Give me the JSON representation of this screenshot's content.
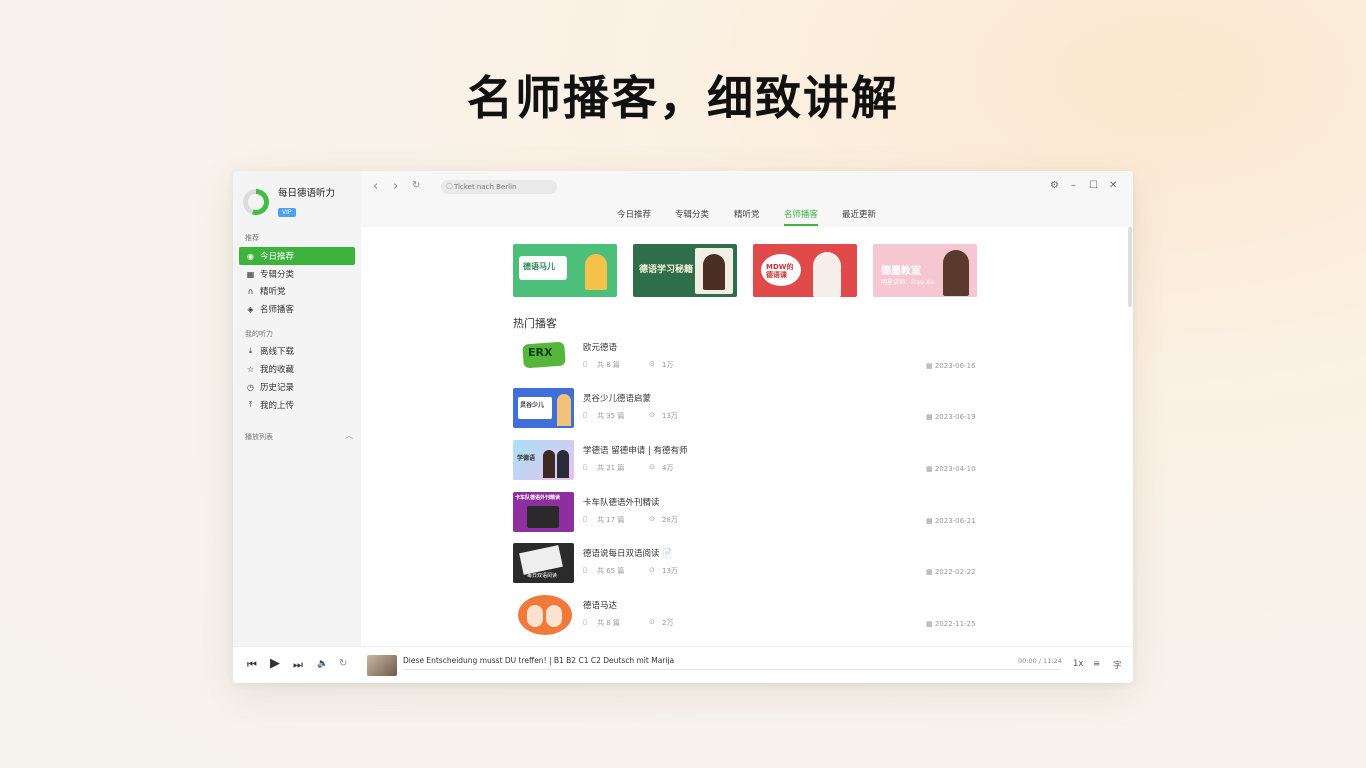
{
  "headline": "名师播客，细致讲解",
  "app": {
    "name": "每日德语听力",
    "badge": "VIP"
  },
  "sidebar": {
    "section1": "推荐",
    "items": [
      {
        "label": "今日推荐",
        "icon": "compass-icon"
      },
      {
        "label": "专辑分类",
        "icon": "grid-icon"
      },
      {
        "label": "精听党",
        "icon": "headphones-icon"
      },
      {
        "label": "名师播客",
        "icon": "podcast-icon"
      }
    ],
    "section2": "我的听力",
    "my_items": [
      {
        "label": "离线下载",
        "icon": "download-icon"
      },
      {
        "label": "我的收藏",
        "icon": "star-icon"
      },
      {
        "label": "历史记录",
        "icon": "clock-icon"
      },
      {
        "label": "我的上传",
        "icon": "upload-icon"
      }
    ],
    "playlist_label": "播放列表"
  },
  "search": {
    "placeholder": "Ticket nach Berlin"
  },
  "tabs": [
    "今日推荐",
    "专辑分类",
    "精听党",
    "名师播客",
    "最近更新"
  ],
  "active_tab": "名师播客",
  "banners": [
    {
      "text": "德语马儿",
      "bg": "#4cc07a"
    },
    {
      "text": "德语学习秘籍",
      "bg": "#2f6e4a"
    },
    {
      "text": "MDW的德语课",
      "bg": "#e04a4a"
    },
    {
      "text": "德墨教室",
      "sub": "明星讲师：Frau Xu",
      "bg": "#f7c6d3"
    }
  ],
  "section_title": "热门播客",
  "podcasts": [
    {
      "title": "欧元德语",
      "episodes": "共 8 篇",
      "plays": "1万",
      "date": "2023-06-16",
      "thumb_text": "ERX"
    },
    {
      "title": "灵谷少儿德语启蒙",
      "episodes": "共 35 篇",
      "plays": "13万",
      "date": "2023-06-19",
      "thumb_text": "灵谷少儿"
    },
    {
      "title": "学德语 留德申请 | 有德有师",
      "episodes": "共 21 篇",
      "plays": "4万",
      "date": "2023-04-10",
      "thumb_text": "学德语"
    },
    {
      "title": "卡车队德语外刊精读",
      "episodes": "共 17 篇",
      "plays": "28万",
      "date": "2023-06-21",
      "thumb_text": "卡车队德语外刊精读"
    },
    {
      "title": "德语说每日双语阅读 📄",
      "episodes": "共 65 篇",
      "plays": "13万",
      "date": "2022-02-22",
      "thumb_text": "每日双语阅读"
    },
    {
      "title": "德语马达",
      "episodes": "共 8 篇",
      "plays": "2万",
      "date": "2022-11-25",
      "thumb_text": ""
    }
  ],
  "player": {
    "track": "Diese Entscheidung musst DU treffen! | B1 B2 C1 C2 Deutsch mit Marija",
    "time": "00:00 / 11:24",
    "speed": "1x",
    "lyrics": "字"
  }
}
